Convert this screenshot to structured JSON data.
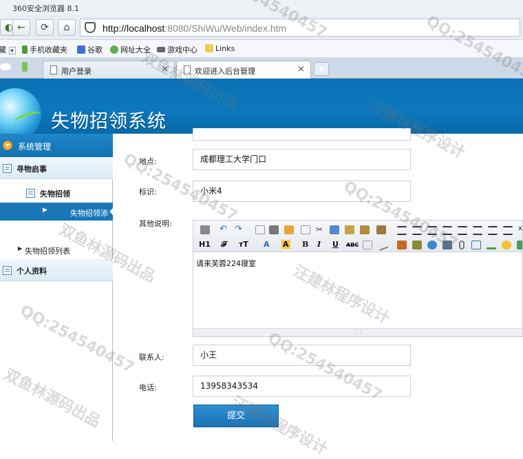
{
  "browser": {
    "window_title": "360安全浏览器 8.1",
    "url_host": "http://localhost",
    "url_rest": ":8080/ShiWu/Web/index.htm",
    "bookmarks": [
      {
        "label": "藏",
        "icon": "dropdown-icon"
      },
      {
        "label": "手机收藏夹",
        "icon": "phone-icon"
      },
      {
        "label": "谷歌",
        "icon": "google-icon"
      },
      {
        "label": "网址大全",
        "icon": "globe-icon"
      },
      {
        "label": "游戏中心",
        "icon": "gamepad-icon"
      },
      {
        "label": "Links",
        "icon": "folder-icon"
      }
    ],
    "tabs": [
      {
        "label": "用户登录",
        "active": false
      },
      {
        "label": "欢迎进入后台管理",
        "active": true
      }
    ],
    "new_tab_label": "+",
    "close_label": "×"
  },
  "app": {
    "title": "失物招领系统"
  },
  "sidebar": {
    "section_title": "系统管理",
    "groups": [
      {
        "label": "寻物启事"
      },
      {
        "label": "个人资料"
      }
    ],
    "sub_item": "失物招领",
    "selected_item": "失物招领添",
    "list_item": "失物招领列表"
  },
  "form": {
    "fields": [
      {
        "label": "地点:",
        "value": "成都理工大学门口"
      },
      {
        "label": "标识:",
        "value": "小米4"
      },
      {
        "label": "其他说明:",
        "value": ""
      },
      {
        "label": "联系人:",
        "value": "小王"
      },
      {
        "label": "电话:",
        "value": "13958343534"
      }
    ],
    "editor": {
      "content": "请来芙蓉224寝室",
      "toolbar_selects": [
        "H1",
        "𝓕",
        "тT",
        "A",
        "A"
      ],
      "toolbar_letters": [
        "B",
        "I",
        "U",
        "ABC"
      ]
    },
    "submit_label": "提交"
  },
  "watermark": {
    "qq": "QQ:254540457",
    "name1": "汪建林程序设计",
    "name2": "双鱼林源码出品"
  },
  "colors": {
    "header_blue": "#0b78bd",
    "sidebar_selected": "#1977b8",
    "submit_blue": "#1b73b5"
  }
}
